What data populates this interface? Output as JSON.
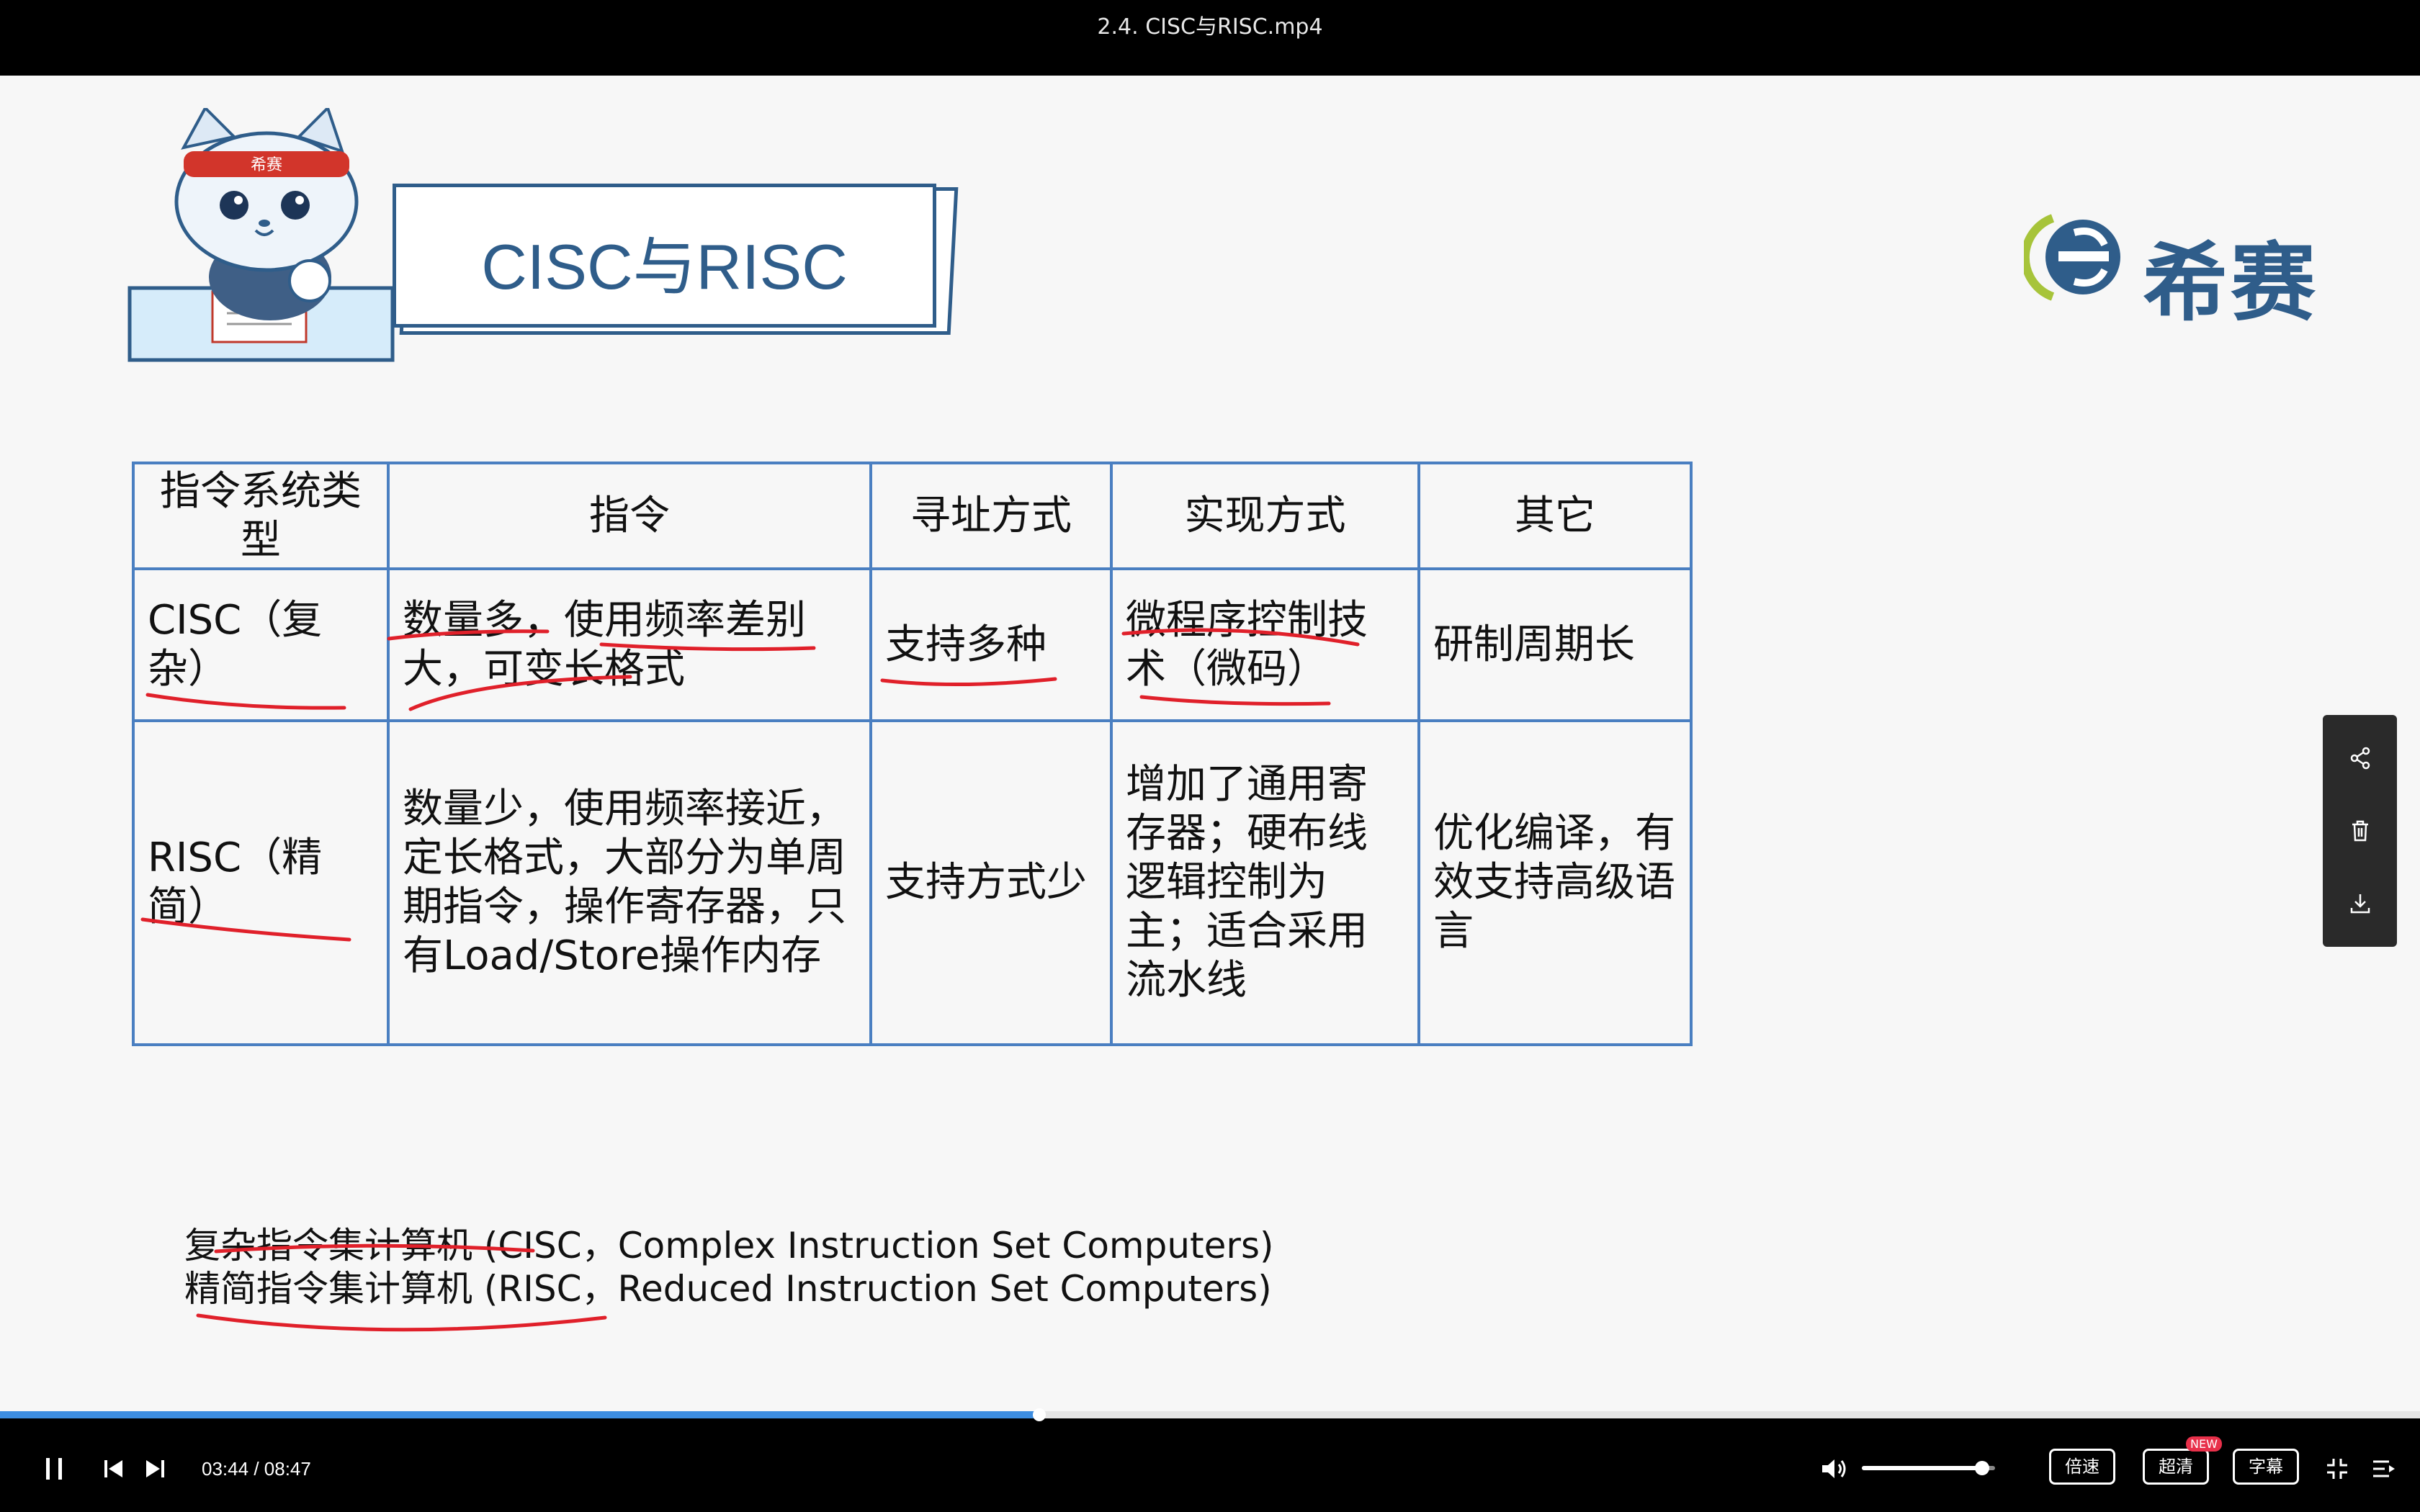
{
  "window": {
    "title": "2.4. CISC与RISC.mp4"
  },
  "slide": {
    "header_title": "CISC与RISC",
    "cat_headband": "希赛",
    "logo_text": "希赛",
    "table": {
      "headers": [
        "指令系统类型",
        "指令",
        "寻址方式",
        "实现方式",
        "其它"
      ],
      "rows": [
        [
          "CISC（复杂）",
          "数量多，使用频率差别大，可变长格式",
          "支持多种",
          "微程序控制技术（微码）",
          "研制周期长"
        ],
        [
          "RISC（精简）",
          "数量少，使用频率接近，定长格式，大部分为单周期指令，操作寄存器，只有Load/Store操作内存",
          "支持方式少",
          "增加了通用寄存器；硬布线逻辑控制为主；适合采用流水线",
          "优化编译，有效支持高级语言"
        ]
      ]
    },
    "notes": [
      "复杂指令集计算机 (CISC，Complex Instruction Set Computers)",
      "精简指令集计算机 (RISC，Reduced Instruction Set Computers)"
    ],
    "annotation_color": "#e0202a"
  },
  "side_panel": {
    "buttons": [
      "share-icon",
      "delete-icon",
      "download-icon"
    ]
  },
  "player": {
    "current_time": "03:44",
    "separator": "/",
    "duration": "08:47",
    "progress": 0.4295,
    "volume": 0.9,
    "speed_label": "倍速",
    "quality_label": "超清",
    "quality_badge": "NEW",
    "subtitle_label": "字幕",
    "accent_color": "#3d8de0"
  }
}
